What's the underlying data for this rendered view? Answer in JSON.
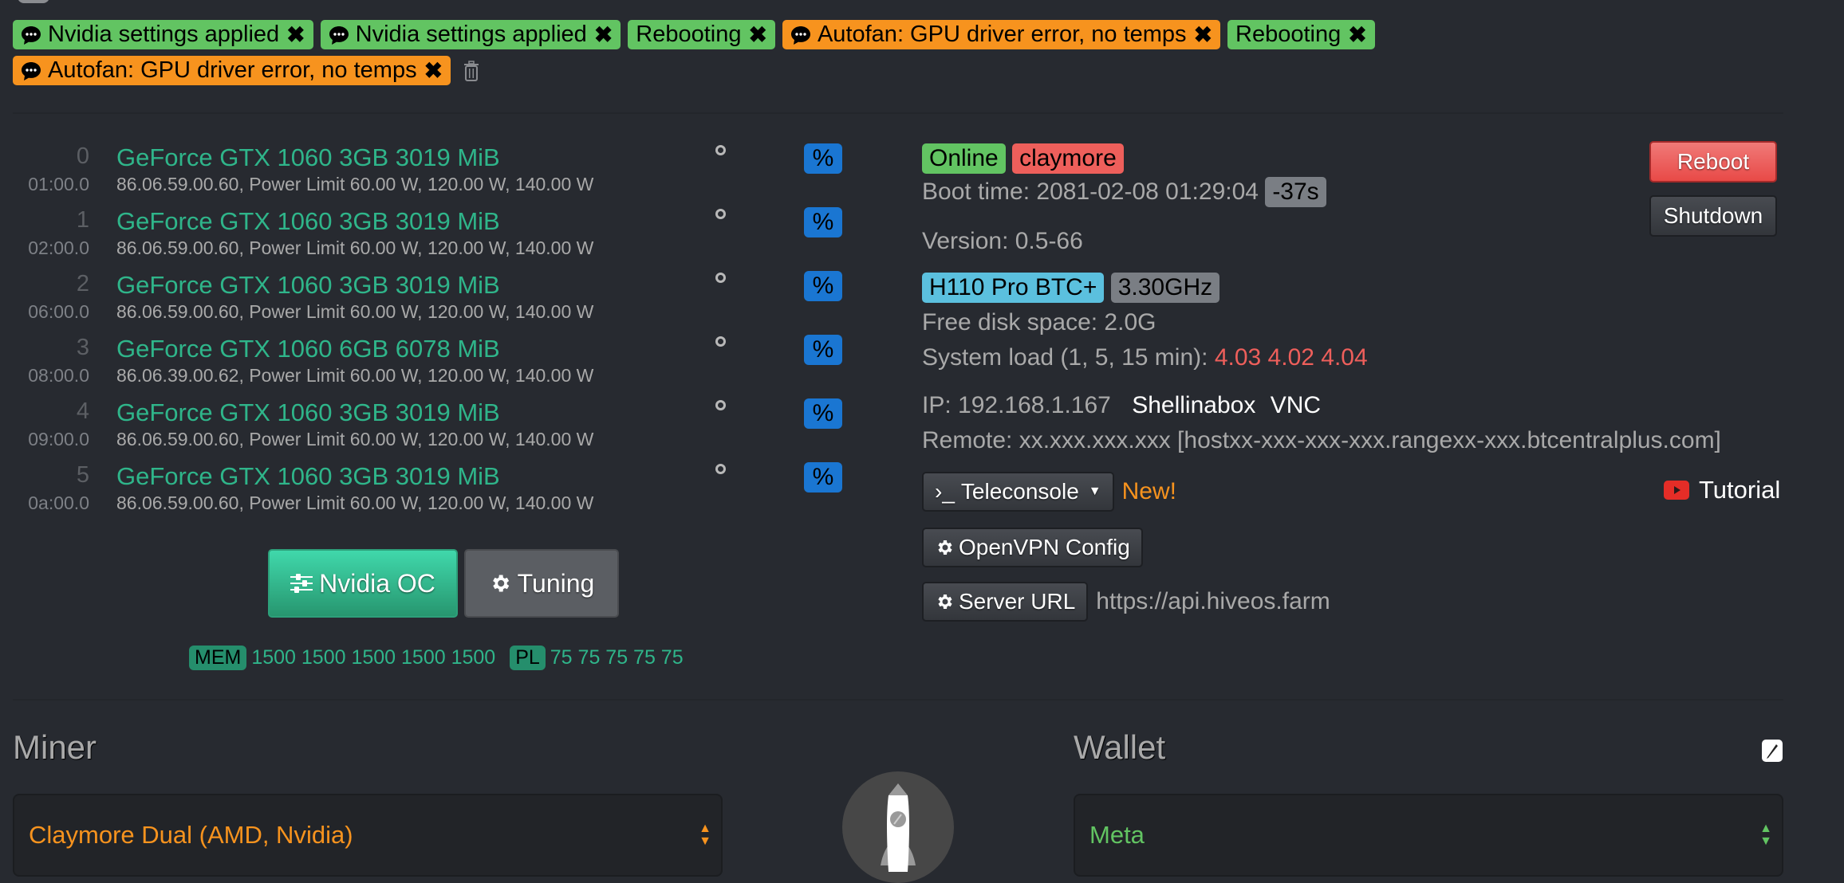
{
  "notifications": {
    "row1": [
      {
        "text": "Nvidia settings applied",
        "color": "green",
        "icon": "chat-icon"
      },
      {
        "text": "Nvidia settings applied",
        "color": "green",
        "icon": "chat-icon"
      },
      {
        "text": "Rebooting",
        "color": "green",
        "icon": null
      },
      {
        "text": "Autofan: GPU driver error, no temps",
        "color": "orange",
        "icon": "chat-icon"
      },
      {
        "text": "Rebooting",
        "color": "green",
        "icon": null
      }
    ],
    "row2": [
      {
        "text": "Autofan: GPU driver error, no temps",
        "color": "orange",
        "icon": "chat-icon"
      }
    ],
    "close_glyph": "✖"
  },
  "gpus": [
    {
      "index": "0",
      "bus": "01:00.0",
      "name": "GeForce GTX 1060 3GB 3019 MiB",
      "info": "86.06.59.00.60, Power Limit 60.00 W, 120.00 W, 140.00 W",
      "temp": "°",
      "fan": "%"
    },
    {
      "index": "1",
      "bus": "02:00.0",
      "name": "GeForce GTX 1060 3GB 3019 MiB",
      "info": "86.06.59.00.60, Power Limit 60.00 W, 120.00 W, 140.00 W",
      "temp": "°",
      "fan": "%"
    },
    {
      "index": "2",
      "bus": "06:00.0",
      "name": "GeForce GTX 1060 3GB 3019 MiB",
      "info": "86.06.59.00.60, Power Limit 60.00 W, 120.00 W, 140.00 W",
      "temp": "°",
      "fan": "%"
    },
    {
      "index": "3",
      "bus": "08:00.0",
      "name": "GeForce GTX 1060 6GB 6078 MiB",
      "info": "86.06.39.00.62, Power Limit 60.00 W, 120.00 W, 140.00 W",
      "temp": "°",
      "fan": "%"
    },
    {
      "index": "4",
      "bus": "09:00.0",
      "name": "GeForce GTX 1060 3GB 3019 MiB",
      "info": "86.06.59.00.60, Power Limit 60.00 W, 120.00 W, 140.00 W",
      "temp": "°",
      "fan": "%"
    },
    {
      "index": "5",
      "bus": "0a:00.0",
      "name": "GeForce GTX 1060 3GB 3019 MiB",
      "info": "86.06.59.00.60, Power Limit 60.00 W, 120.00 W, 140.00 W",
      "temp": "°",
      "fan": "%"
    }
  ],
  "oc": {
    "nvidia_oc_label": "Nvidia OC",
    "tuning_label": "Tuning",
    "mem_label": "MEM",
    "mem_values": "1500 1500 1500 1500 1500",
    "pl_label": "PL",
    "pl_values": "75 75 75 75 75"
  },
  "rig": {
    "status": "Online",
    "miner_badge": "claymore",
    "boot_time_label": "Boot time: 2081-02-08 01:29:04",
    "boot_offset": "-37s",
    "version": "Version: 0.5-66",
    "motherboard": "H110 Pro BTC+",
    "cpu_freq": "3.30GHz",
    "free_disk": "Free disk space: 2.0G",
    "load_label": "System load (1, 5, 15 min):",
    "load_values": "4.03 4.02 4.04",
    "ip": "IP: 192.168.1.167",
    "shellinabox": "Shellinabox",
    "vnc": "VNC",
    "remote": "Remote: xx.xxx.xxx.xxx [hostxx-xxx-xxx-xxx.rangexx-xxx.btcentralplus.com]",
    "teleconsole_label": "Teleconsole",
    "teleconsole_prompt": "›_",
    "new_label": "New!",
    "tutorial_label": "Tutorial",
    "openvpn_label": "OpenVPN Config",
    "server_url_label": "Server URL",
    "server_url": "https://api.hiveos.farm",
    "reboot_label": "Reboot",
    "shutdown_label": "Shutdown"
  },
  "miner": {
    "heading": "Miner",
    "selected": "Claymore Dual (AMD, Nvidia)",
    "color": "#f7931e"
  },
  "wallet": {
    "heading": "Wallet",
    "selected": "Meta",
    "color": "#62c462"
  }
}
